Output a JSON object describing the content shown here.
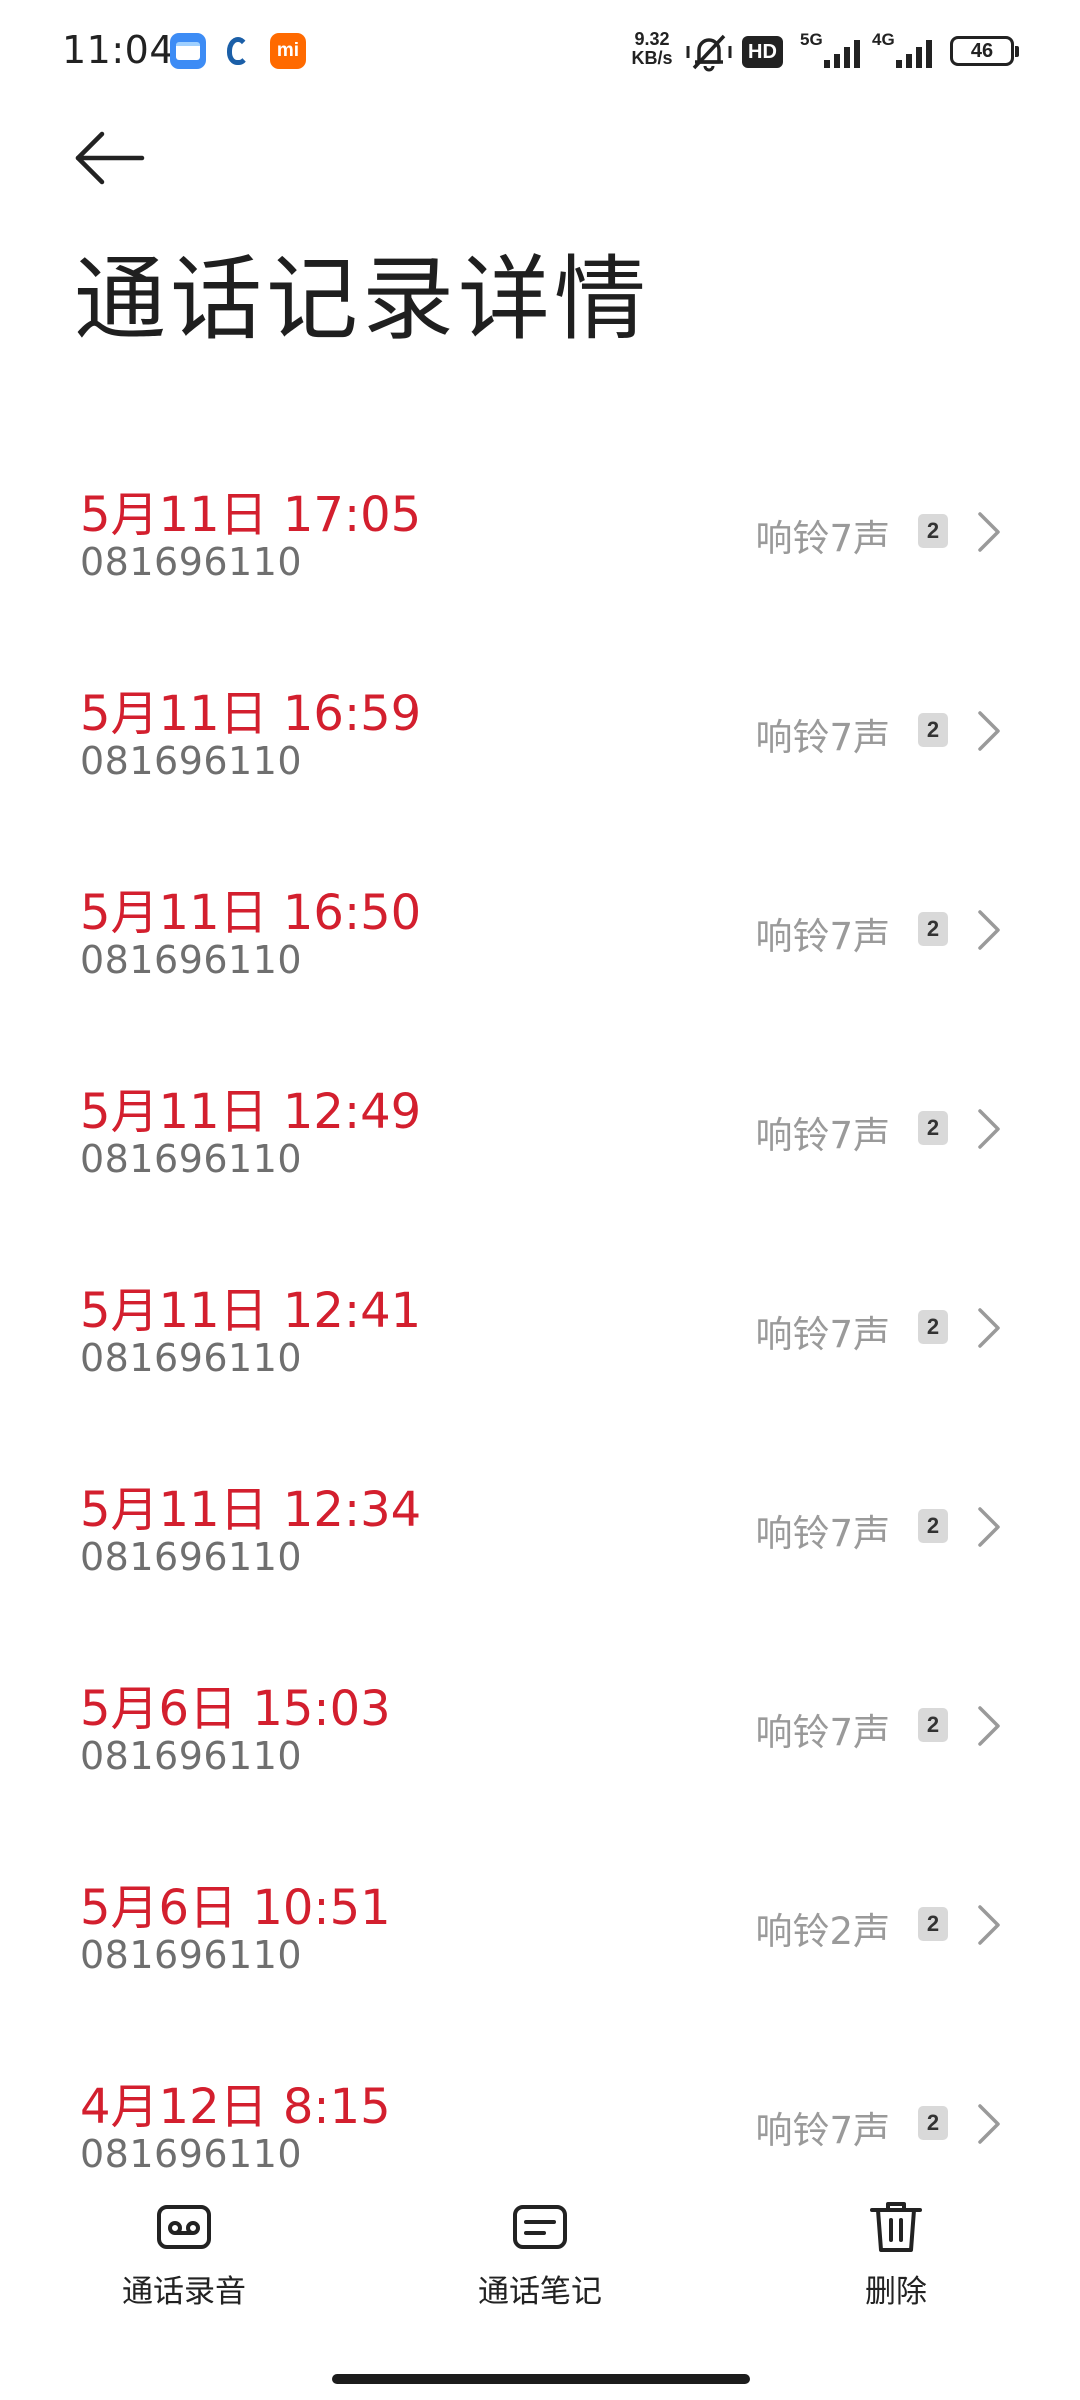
{
  "status_bar": {
    "time": "11:04",
    "net_speed_value": "9.32",
    "net_speed_unit": "KB/s",
    "hd_label": "HD",
    "network_1": "5G",
    "network_2": "4G",
    "battery": "46",
    "app_icons": [
      "wallet-icon",
      "penguin-icon",
      "mi-icon"
    ],
    "mi_label": "mi"
  },
  "header": {
    "title": "通话记录详情",
    "back_icon": "arrow-left-icon"
  },
  "calls": [
    {
      "datetime": "5月11日 17:05",
      "number": "081696110",
      "ring": "响铃7声",
      "sim": "2"
    },
    {
      "datetime": "5月11日 16:59",
      "number": "081696110",
      "ring": "响铃7声",
      "sim": "2"
    },
    {
      "datetime": "5月11日 16:50",
      "number": "081696110",
      "ring": "响铃7声",
      "sim": "2"
    },
    {
      "datetime": "5月11日 12:49",
      "number": "081696110",
      "ring": "响铃7声",
      "sim": "2"
    },
    {
      "datetime": "5月11日 12:41",
      "number": "081696110",
      "ring": "响铃7声",
      "sim": "2"
    },
    {
      "datetime": "5月11日 12:34",
      "number": "081696110",
      "ring": "响铃7声",
      "sim": "2"
    },
    {
      "datetime": "5月6日 15:03",
      "number": "081696110",
      "ring": "响铃7声",
      "sim": "2"
    },
    {
      "datetime": "5月6日 10:51",
      "number": "081696110",
      "ring": "响铃2声",
      "sim": "2"
    },
    {
      "datetime": "4月12日 8:15",
      "number": "081696110",
      "ring": "响铃7声",
      "sim": "2"
    }
  ],
  "bottom_bar": {
    "recording_label": "通话录音",
    "notes_label": "通话笔记",
    "delete_label": "删除"
  },
  "colors": {
    "accent_red": "#d31f2e",
    "secondary_text": "#6f6f6f",
    "ring_text": "#9a9a9a"
  }
}
